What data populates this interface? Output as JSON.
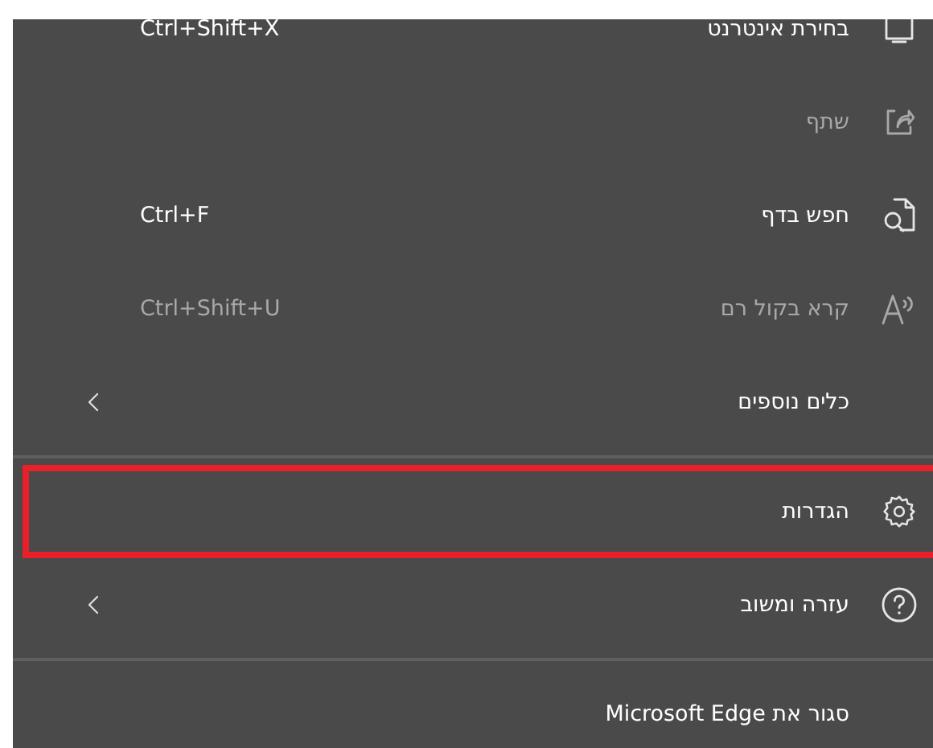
{
  "menu": {
    "items": [
      {
        "label": "בחירת אינטרנט",
        "shortcut": "Ctrl+Shift+X",
        "disabled": false,
        "submenu": false,
        "highlighted": false,
        "divider_before": false
      },
      {
        "label": "שתף",
        "disabled": true,
        "submenu": false,
        "highlighted": false,
        "divider_before": false
      },
      {
        "label": "חפש בדף",
        "shortcut": "Ctrl+F",
        "disabled": false,
        "submenu": false,
        "highlighted": false,
        "divider_before": false
      },
      {
        "label": "קרא בקול רם",
        "shortcut": "Ctrl+Shift+U",
        "disabled": true,
        "submenu": false,
        "highlighted": false,
        "divider_before": false
      },
      {
        "label": "כלים נוספים",
        "disabled": false,
        "submenu": true,
        "highlighted": false,
        "divider_before": false
      },
      {
        "label": "הגדרות",
        "disabled": false,
        "submenu": false,
        "highlighted": true,
        "divider_before": true
      },
      {
        "label": "עזרה ומשוב",
        "disabled": false,
        "submenu": true,
        "highlighted": false,
        "divider_before": false
      },
      {
        "label": "סגור את Microsoft Edge",
        "disabled": false,
        "submenu": false,
        "highlighted": false,
        "divider_before": true
      }
    ]
  }
}
